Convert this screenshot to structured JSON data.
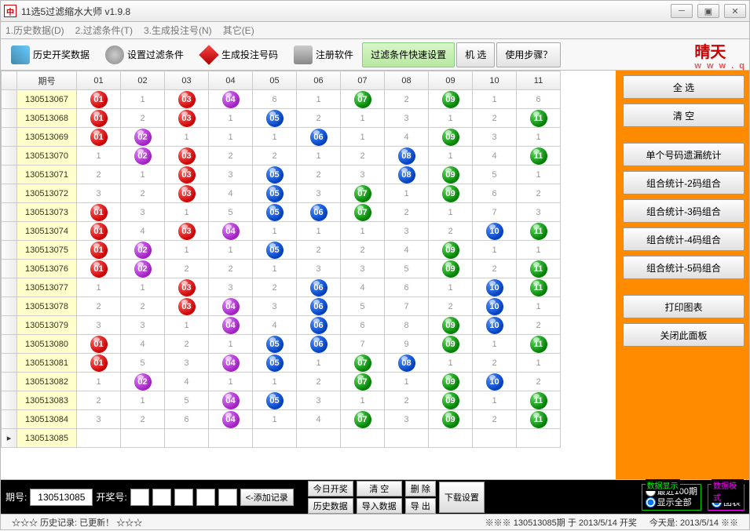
{
  "title": "11选5过滤缩水大师 v1.9.8",
  "menu": [
    "1.历史数据(D)",
    "2.过滤条件(T)",
    "3.生成投注号(N)",
    "其它(E)"
  ],
  "toolbar": {
    "history": "历史开奖数据",
    "filter": "设置过滤条件",
    "generate": "生成投注号码",
    "register": "注册软件",
    "quickfilter": "过滤条件快速设置",
    "random": "机 选",
    "help": "使用步骤？"
  },
  "logo": {
    "main": "晴天",
    "sub": "w w w . q"
  },
  "headers": [
    "期号",
    "01",
    "02",
    "03",
    "04",
    "05",
    "06",
    "07",
    "08",
    "09",
    "10",
    "11"
  ],
  "rows": [
    {
      "issue": "130513067",
      "cells": [
        [
          1,
          "r"
        ],
        "1",
        [
          3,
          "r"
        ],
        [
          4,
          "p"
        ],
        "6",
        "1",
        [
          7,
          "g"
        ],
        "2",
        [
          9,
          "g"
        ],
        "1",
        "6"
      ]
    },
    {
      "issue": "130513068",
      "cells": [
        [
          1,
          "r"
        ],
        "2",
        [
          3,
          "r"
        ],
        "1",
        [
          5,
          "b"
        ],
        "2",
        "1",
        "3",
        "1",
        "2",
        [
          11,
          "g"
        ]
      ]
    },
    {
      "issue": "130513069",
      "cells": [
        [
          1,
          "r"
        ],
        [
          2,
          "p"
        ],
        "1",
        "1",
        "1",
        [
          6,
          "b"
        ],
        "1",
        "4",
        [
          9,
          "g"
        ],
        "3",
        "1"
      ]
    },
    {
      "issue": "130513070",
      "cells": [
        "1",
        [
          2,
          "p"
        ],
        [
          3,
          "r"
        ],
        "2",
        "2",
        "1",
        "2",
        [
          8,
          "b"
        ],
        "1",
        "4",
        [
          11,
          "g"
        ]
      ]
    },
    {
      "issue": "130513071",
      "cells": [
        "2",
        "1",
        [
          3,
          "r"
        ],
        "3",
        [
          5,
          "b"
        ],
        "2",
        "3",
        [
          8,
          "b"
        ],
        [
          9,
          "g"
        ],
        "5",
        "1"
      ]
    },
    {
      "issue": "130513072",
      "cells": [
        "3",
        "2",
        [
          3,
          "r"
        ],
        "4",
        [
          5,
          "b"
        ],
        "3",
        [
          7,
          "g"
        ],
        "1",
        [
          9,
          "g"
        ],
        "6",
        "2"
      ]
    },
    {
      "issue": "130513073",
      "cells": [
        [
          1,
          "r"
        ],
        "3",
        "1",
        "5",
        [
          5,
          "b"
        ],
        [
          6,
          "b"
        ],
        [
          7,
          "g"
        ],
        "2",
        "1",
        "7",
        "3"
      ]
    },
    {
      "issue": "130513074",
      "cells": [
        [
          1,
          "r"
        ],
        "4",
        [
          3,
          "r"
        ],
        [
          4,
          "p"
        ],
        "1",
        "1",
        "1",
        "3",
        "2",
        [
          10,
          "b"
        ],
        [
          11,
          "g"
        ]
      ]
    },
    {
      "issue": "130513075",
      "cells": [
        [
          1,
          "r"
        ],
        [
          2,
          "p"
        ],
        "1",
        "1",
        [
          5,
          "b"
        ],
        "2",
        "2",
        "4",
        [
          9,
          "g"
        ],
        "1",
        "1"
      ]
    },
    {
      "issue": "130513076",
      "cells": [
        [
          1,
          "r"
        ],
        [
          2,
          "p"
        ],
        "2",
        "2",
        "1",
        "3",
        "3",
        "5",
        [
          9,
          "g"
        ],
        "2",
        [
          11,
          "g"
        ]
      ]
    },
    {
      "issue": "130513077",
      "cells": [
        "1",
        "1",
        [
          3,
          "r"
        ],
        "3",
        "2",
        [
          6,
          "b"
        ],
        "4",
        "6",
        "1",
        [
          10,
          "b"
        ],
        [
          11,
          "g"
        ]
      ]
    },
    {
      "issue": "130513078",
      "cells": [
        "2",
        "2",
        [
          3,
          "r"
        ],
        [
          4,
          "p"
        ],
        "3",
        [
          6,
          "b"
        ],
        "5",
        "7",
        "2",
        [
          10,
          "b"
        ],
        "1"
      ]
    },
    {
      "issue": "130513079",
      "cells": [
        "3",
        "3",
        "1",
        [
          4,
          "p"
        ],
        "4",
        [
          6,
          "b"
        ],
        "6",
        "8",
        [
          9,
          "g"
        ],
        [
          10,
          "b"
        ],
        "2"
      ]
    },
    {
      "issue": "130513080",
      "cells": [
        [
          1,
          "r"
        ],
        "4",
        "2",
        "1",
        [
          5,
          "b"
        ],
        [
          6,
          "b"
        ],
        "7",
        "9",
        [
          9,
          "g"
        ],
        "1",
        [
          11,
          "g"
        ]
      ]
    },
    {
      "issue": "130513081",
      "cells": [
        [
          1,
          "r"
        ],
        "5",
        "3",
        [
          4,
          "p"
        ],
        [
          5,
          "b"
        ],
        "1",
        [
          7,
          "g"
        ],
        [
          8,
          "b"
        ],
        "1",
        "2",
        "1"
      ]
    },
    {
      "issue": "130513082",
      "cells": [
        "1",
        [
          2,
          "p"
        ],
        "4",
        "1",
        "1",
        "2",
        [
          7,
          "g"
        ],
        "1",
        [
          9,
          "g"
        ],
        [
          10,
          "b"
        ],
        "2"
      ]
    },
    {
      "issue": "130513083",
      "cells": [
        "2",
        "1",
        "5",
        [
          4,
          "p"
        ],
        [
          5,
          "b"
        ],
        "3",
        "1",
        "2",
        [
          9,
          "g"
        ],
        "1",
        [
          11,
          "g"
        ]
      ]
    },
    {
      "issue": "130513084",
      "cells": [
        "3",
        "2",
        "6",
        [
          4,
          "p"
        ],
        "1",
        "4",
        [
          7,
          "g"
        ],
        "3",
        [
          9,
          "g"
        ],
        "2",
        [
          11,
          "g"
        ]
      ]
    },
    {
      "issue": "130513085",
      "cells": [
        "",
        "",
        "",
        "",
        "",
        "",
        "",
        "",
        "",
        "",
        ""
      ]
    }
  ],
  "ball_colors": {
    "r": "red",
    "p": "purple",
    "b": "blue",
    "g": "green"
  },
  "sidepanel": {
    "select_all": "全 选",
    "clear": "清 空",
    "stat1": "单个号码遗漏统计",
    "stat2": "组合统计-2码组合",
    "stat3": "组合统计-3码组合",
    "stat4": "组合统计-4码组合",
    "stat5": "组合统计-5码组合",
    "print": "打印图表",
    "close": "关闭此面板"
  },
  "inputbar": {
    "issue_label": "期号:",
    "issue_value": "130513085",
    "draw_label": "开奖号:",
    "add": "<-添加记录",
    "today": "今日开奖",
    "history": "历史数据",
    "clear": "清 空",
    "import": "导入数据",
    "delete": "删 除",
    "export": "导 出",
    "download": "下载设置",
    "display_title": "数据显示",
    "latest100": "最近100期",
    "showall": "显示全部",
    "mode_title": "数据模式",
    "data": "数据",
    "chart": "图表"
  },
  "status": {
    "left": "☆☆☆ 历史记录:  已更新！  ☆☆☆",
    "mid": "※※※  130513085期 于 2013/5/14 开奖",
    "right": "今天是:  2013/5/14 ※※"
  }
}
